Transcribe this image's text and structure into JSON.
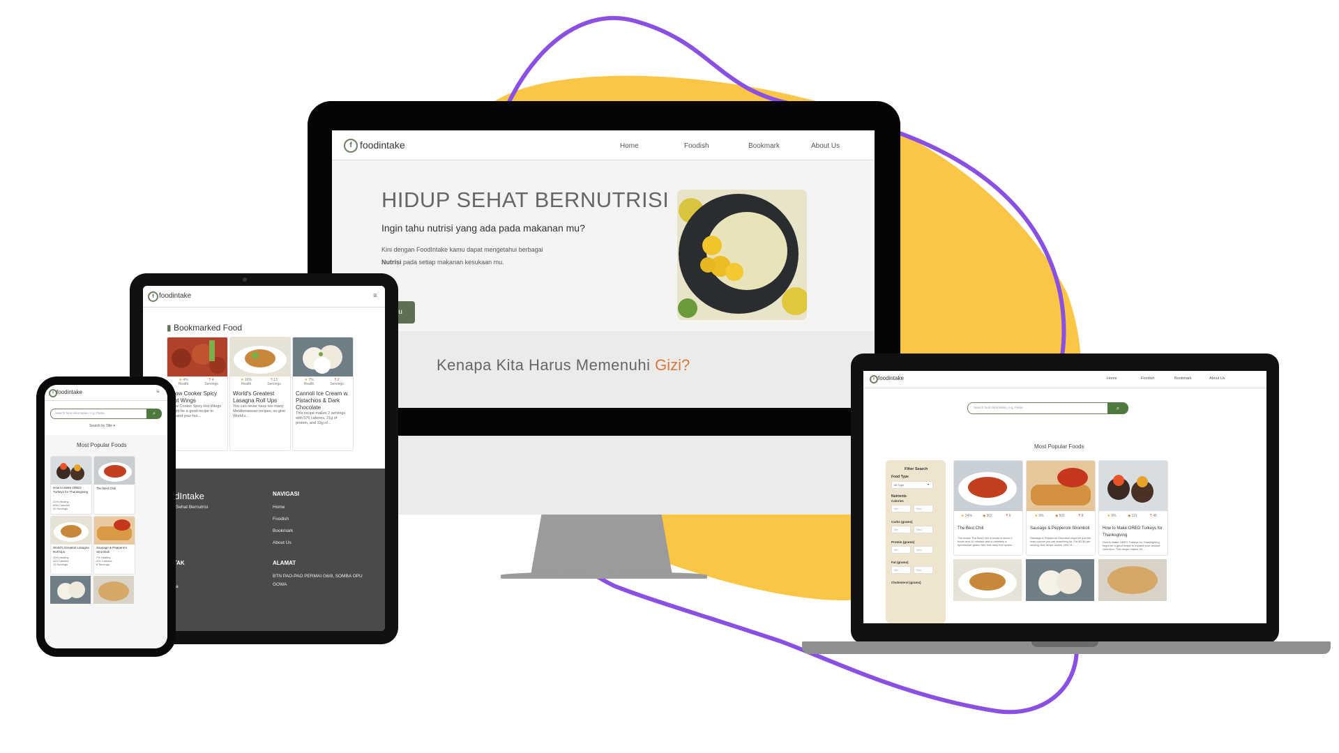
{
  "colors": {
    "accent_green": "#5f6f55",
    "blob_yellow": "#fbc645",
    "swoosh_purple": "#8a4fe3",
    "accent_orange": "#d9773a",
    "footer_dark": "#4a4a48"
  },
  "desktop": {
    "brand": "foodintake",
    "nav": [
      "Home",
      "Foodish",
      "Bookmark",
      "About Us"
    ],
    "hero_title": "HIDUP SEHAT BERNUTRISI",
    "hero_subtitle": "Ingin tahu nutrisi yang ada pada makanan mu?",
    "hero_p1": "Kini dengan FoodIntake kamu dapat mengetahui berbagai",
    "hero_p2_bold": "Nutrisi",
    "hero_p2_rest": " pada setiap makanan kesukaan mu.",
    "hero_button": "enu",
    "why_text": "Kenapa Kita Harus Memenuhi ",
    "why_accent": "Gizi?"
  },
  "tablet": {
    "brand": "foodintake",
    "section_title": "Bookmarked Food",
    "cards": [
      {
        "title": "Slow Cooker Spicy Hot Wings",
        "s1": "4%",
        "s1l": "Health",
        "s2": "4",
        "s2l": "Servings",
        "desc": "Slow Cooker Spicy Hot Wings might be a good recipe to expand your hor..."
      },
      {
        "title": "World's Greatest Lasagna Roll Ups",
        "s1": "10%",
        "s1l": "Health",
        "s2": "13",
        "s2l": "Servings",
        "desc": "You can never have too many Mediterranean recipes, so give World's..."
      },
      {
        "title": "Cannoli Ice Cream w. Pistachios & Dark Chocolate",
        "s1": "7%",
        "s1l": "Health",
        "s2": "2",
        "s2l": "Servings",
        "desc": "This recipe makes 2 servings with 576 calories, 21g of protein, and 33g of..."
      }
    ],
    "footer": {
      "brand": "odIntake",
      "tagline": "up Sehat Bernutrisi",
      "nav_h": "NAVIGASI",
      "nav": [
        "Home",
        "Foodish",
        "Bookmark",
        "About Us"
      ],
      "contact_h": "NTAK",
      "contact": [
        "n",
        "anta",
        "an"
      ],
      "addr_h": "ALAMAT",
      "addr": "BTN PAO-PAO PERMAI G6/8, SOMBA OPU GOWA"
    }
  },
  "phone": {
    "brand": "foodintake",
    "search_placeholder": "Search food information, e.g. Pasta",
    "search_by": "Search by Title ▾",
    "section_title": "Most Popular Foods",
    "cards": [
      {
        "title": "How to Make OREO Turkeys for Thanksgiving",
        "l1": "22% Healthy",
        "l2": "69% Calories",
        "l3": "90 Servings"
      },
      {
        "title": "The Best Chili",
        "l1": "",
        "l2": "",
        "l3": ""
      },
      {
        "title": "World's Greatest Lasagna Roll Ups",
        "l1": "10% Healthy",
        "l2": "424 Calories",
        "l3": "13 Servings"
      },
      {
        "title": "Sausage & Pepperoni Stromboli",
        "l1": "7% Healthy",
        "l2": "221 Calories",
        "l3": "8 Servings"
      }
    ]
  },
  "laptop": {
    "brand": "foodintake",
    "nav": [
      "Home",
      "Foodish",
      "Bookmark",
      "About Us"
    ],
    "search_placeholder": "Search food information, e.g. Pasta",
    "section_title": "Most Popular Foods",
    "filter": {
      "title": "Filter Search",
      "food_type": "Food Type",
      "food_type_value": "All Type",
      "nutrients": "Nutrients",
      "calories": "Calories",
      "carbs": "Carbs (grams)",
      "protein": "Protein (grams)",
      "fat": "Fat (grams)",
      "cholesterol": "Cholesterol (grams)",
      "min": "Min",
      "max": "Max"
    },
    "cards": [
      {
        "title": "The Best Chili",
        "s1": "34%",
        "s2": "302",
        "s3": "6",
        "desc": "The recipe The Best Chili is ready in about 2 hours and 10 minutes and is definitely a spectacular gluten free and dairy free option..."
      },
      {
        "title": "Sausage & Pepperoni Stromboli",
        "s1": "9%",
        "s2": "501",
        "s3": "8",
        "desc": "Sausage & Pepperoni Stromboli might be just the main course you are searching for. For $2.56 per serving, this recipe covers 18% of..."
      },
      {
        "title": "How to Make OREO Turkeys for Thanksgiving",
        "s1": "6%",
        "s2": "121",
        "s3": "45",
        "desc": "How to Make OREO Turkeys for Thanksgiving might be a good recipe to expand your dessert collection. This recipe makes 45..."
      }
    ]
  }
}
